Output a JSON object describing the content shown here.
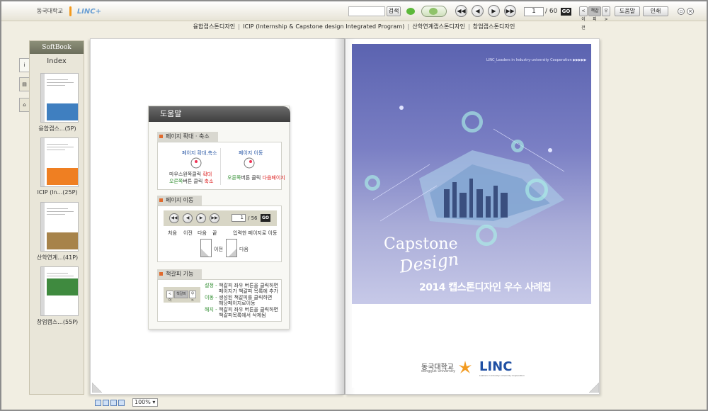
{
  "toolbar": {
    "search_placeholder": "",
    "search_label": "검색",
    "page_current": "1",
    "page_total": "/ 60",
    "go_label": "GO",
    "prev_bookmark": "<이전",
    "bookmark_label": "책갈피",
    "next_bookmark": "우>",
    "help_label": "도움말",
    "print_label": "인쇄"
  },
  "logo": {
    "university": "동국대학교",
    "brand": "LINC+"
  },
  "index_links": [
    "융합캡스톤디자인",
    "ICIP (Internship & Capstone design Integrated Program)",
    "산학연계캡스톤디자인",
    "창업캡스톤디자인"
  ],
  "sidebar": {
    "header": "SoftBook",
    "index_label": "Index",
    "thumbs": [
      {
        "caption": "융합캡스...(5P)",
        "color": "#3f7fc0"
      },
      {
        "caption": "ICIP (In...(25P)",
        "color": "#ef7f22"
      },
      {
        "caption": "산학연계...(41P)",
        "color": "#a7834a"
      },
      {
        "caption": "창업캡스...(55P)",
        "color": "#3f8a3f"
      }
    ]
  },
  "help": {
    "title": "도움말",
    "sec1_title": "페이지 확대 · 축소",
    "zoom_title": "페이지 확대,축소",
    "zoom_l1a": "마우스",
    "zoom_l1b": "왼쪽",
    "zoom_l1c": "클릭 ",
    "zoom_l1d": "확대",
    "zoom_l2a": "오른쪽",
    "zoom_l2b": "버튼 클릭 ",
    "zoom_l2c": "축소",
    "move_title": "페이지 이동",
    "move_l1a": "오른쪽",
    "move_l1b": "버튼 클릭 ",
    "move_l1c": "다음페이지",
    "sec2_title": "페이지 이동",
    "mini_page": "1",
    "mini_total": "/ 56",
    "mini_go": "GO",
    "nav_first": "처음",
    "nav_prev": "이전",
    "nav_next": "다음",
    "nav_last": "끝",
    "nav_input": "입력한 페이지로 이동",
    "corner_prev": "이전",
    "corner_next": "다음",
    "sec3_title": "책갈피 기능",
    "bm_prev": "<이",
    "bm_label": "책갈피",
    "bm_next": "우>",
    "bm_set": "설정 -",
    "bm_set_d1": "책갈피 좌우 버튼을 클릭하면",
    "bm_set_d2": "페이지가 책갈피 목록에 추가",
    "bm_move": "이동 -",
    "bm_move_d1": "생성된 책갈피를 클릭하면",
    "bm_move_d2": "해당페이지로이동",
    "bm_del": "해지 -",
    "bm_del_d1": "책갈피 좌우 버튼을 클릭하면",
    "bm_del_d2": "책갈피목록에서 삭제됨"
  },
  "cover": {
    "tagline": "LINC_Leaders in Industry-university Cooperation ▶▶▶▶▶",
    "title": "Capstone",
    "script": "Design",
    "subtitle": "2014 캡스톤디자인 우수 사례집",
    "uni_name": "동국대학교",
    "uni_en": "dongguk university",
    "linc": "LINC",
    "linc_sub": "Leaders in Industry-university Cooperation"
  },
  "bottom": {
    "zoom_value": "100%"
  }
}
